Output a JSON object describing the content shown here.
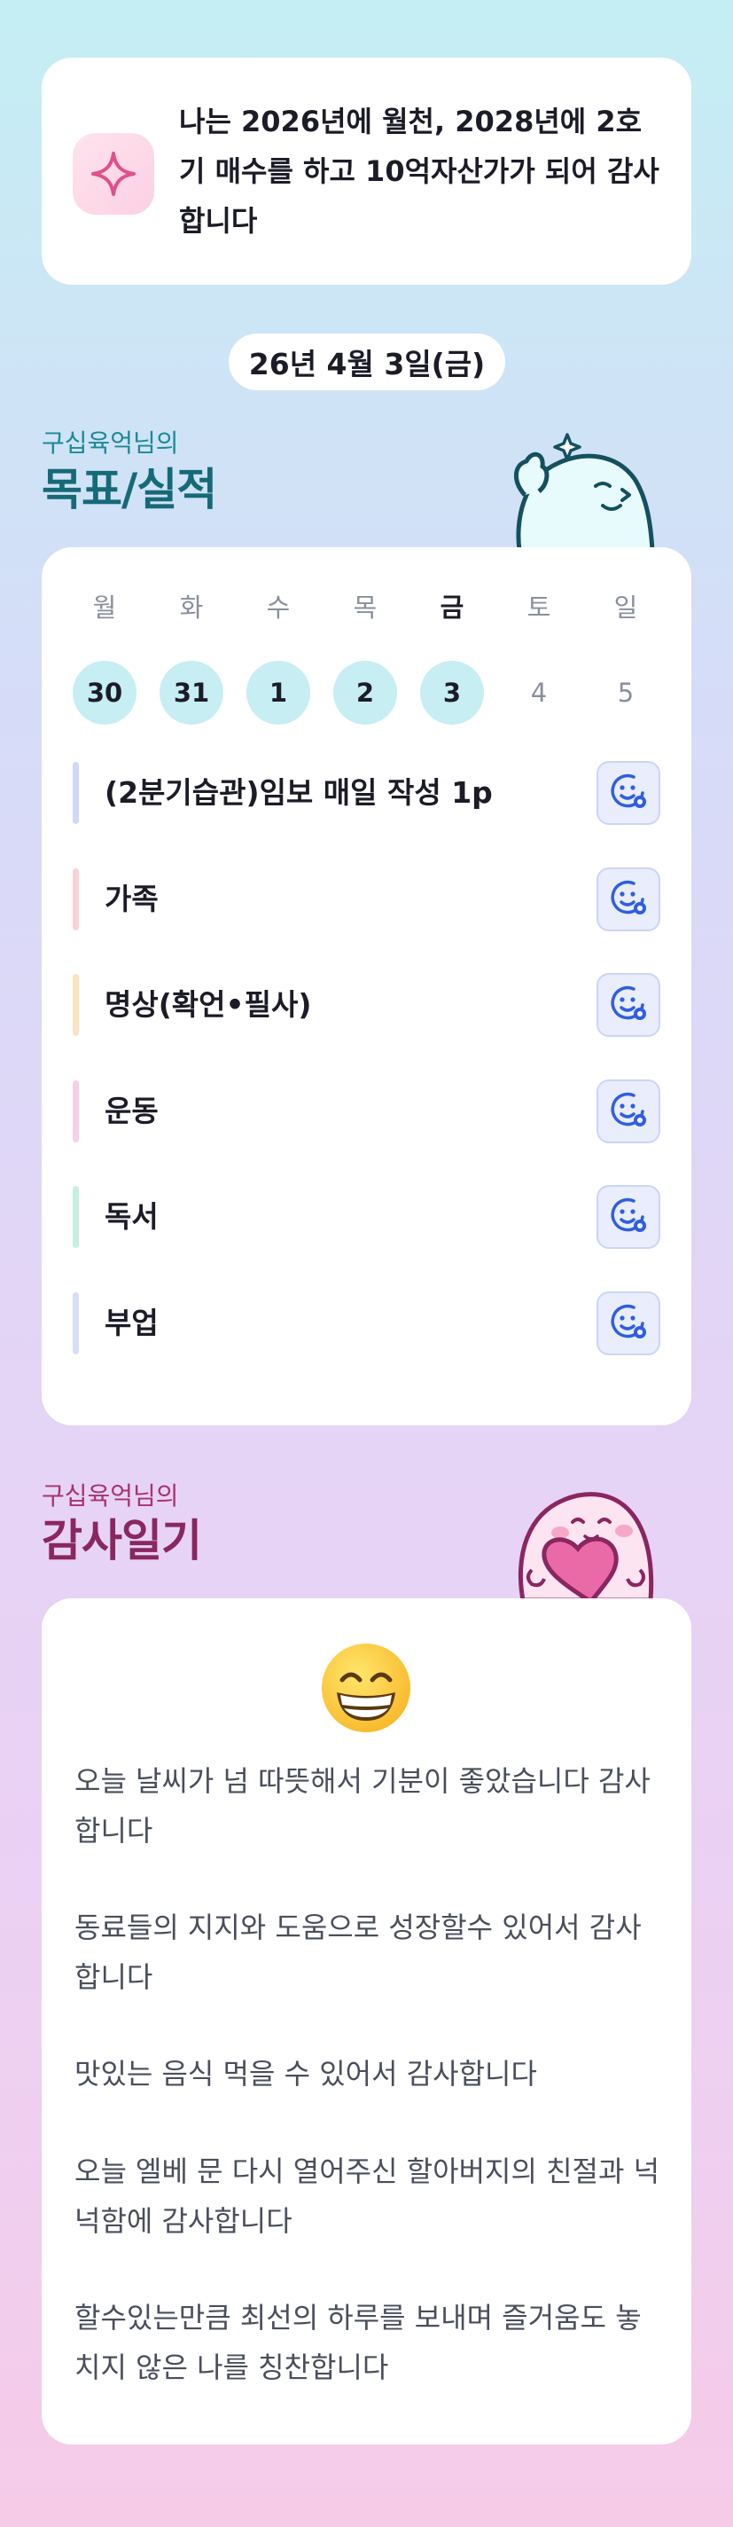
{
  "affirmation": {
    "text": "나는 2026년에 월천, 2028년에 2호기 매수를 하고 10억자산가가 되어 감사합니다",
    "icon": "sparkle-icon"
  },
  "date": "26년 4월 3일(금)",
  "goals_section": {
    "subtitle": "구십육억님의",
    "title": "목표/실적"
  },
  "week": [
    {
      "name": "월",
      "num": "30",
      "status": "done"
    },
    {
      "name": "화",
      "num": "31",
      "status": "done"
    },
    {
      "name": "수",
      "num": "1",
      "status": "done"
    },
    {
      "name": "목",
      "num": "2",
      "status": "done"
    },
    {
      "name": "금",
      "num": "3",
      "status": "done",
      "today": true
    },
    {
      "name": "토",
      "num": "4",
      "status": "none"
    },
    {
      "name": "일",
      "num": "5",
      "status": "none"
    }
  ],
  "goals": [
    {
      "label": "(2분기습관)임보 매일 작성 1p",
      "color": "#cfd8f8"
    },
    {
      "label": "가족",
      "color": "#fbd1d8"
    },
    {
      "label": "명상(확언•필사)",
      "color": "#fbe3bf"
    },
    {
      "label": "운동",
      "color": "#f7cfe8"
    },
    {
      "label": "독서",
      "color": "#c6efe0"
    },
    {
      "label": "부업",
      "color": "#d6def9"
    }
  ],
  "gratitude_section": {
    "subtitle": "구십육억님의",
    "title": "감사일기",
    "mood_icon": "grinning-face-icon"
  },
  "gratitude_entries": [
    "오늘 날씨가 넘 따뜻해서 기분이 좋았습니다 감사합니다",
    "동료들의 지지와 도움으로 성장할수 있어서 감사합니다",
    "맛있는 음식 먹을 수 있어서 감사합니다",
    "오늘 엘베 문 다시 열어주신 할아버지의 친절과 넉넉함에 감사합니다",
    "할수있는만큼 최선의 하루를 보내며 즐거움도 놓치지 않은 나를 칭찬합니다"
  ]
}
